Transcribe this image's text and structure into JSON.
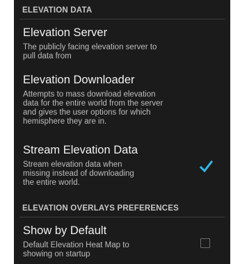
{
  "sections": {
    "elevation_data": "ELEVATION DATA",
    "overlays": "ELEVATION OVERLAYS PREFERENCES"
  },
  "prefs": {
    "server": {
      "title": "Elevation Server",
      "summary_lines": [
        "The publicly facing elevation server to",
        "pull data from"
      ]
    },
    "downloader": {
      "title": "Elevation Downloader",
      "summary_lines": [
        "Attempts to mass download elevation",
        "data for the entire world from the server",
        "and gives the user options for which",
        "hemisphere they are in."
      ]
    },
    "stream": {
      "title": "Stream Elevation Data",
      "summary_lines": [
        "Stream elevation data when",
        "missing instead of downloading",
        "the entire world."
      ],
      "checked": true
    },
    "show_default": {
      "title": "Show by Default",
      "summary_lines": [
        "Default Elevation Heat Map to",
        "showing on startup"
      ],
      "checked": false
    }
  },
  "colors": {
    "background": "#1b1b1b",
    "accent": "#33b5e5",
    "header_text": "#c7c7c7",
    "summary_text": "#bdbdbd"
  }
}
